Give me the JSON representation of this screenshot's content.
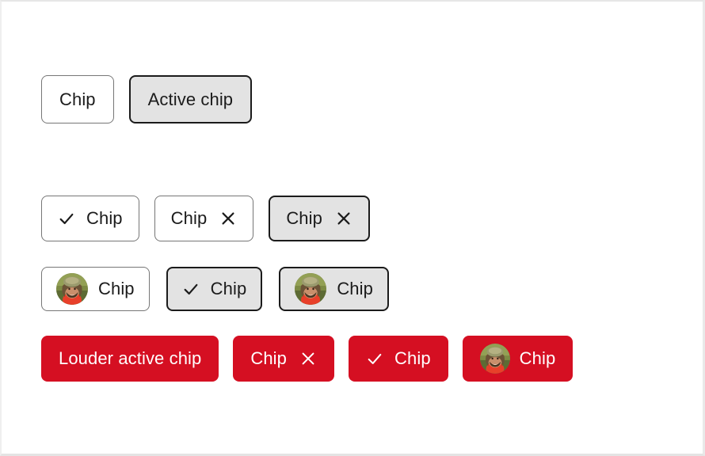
{
  "page": {
    "background": "#ffffff",
    "accent_red": "#d50f22",
    "border_gray": "#767676",
    "active_fill": "#e3e3e3",
    "text_color": "#1b1b1b"
  },
  "rows": {
    "basic": {
      "name": "basic-chips-row",
      "chips": [
        {
          "label": "Chip",
          "state": "default"
        },
        {
          "label": "Active chip",
          "state": "active"
        }
      ]
    },
    "icon_chips": {
      "name": "icon-chips-row",
      "chips": [
        {
          "label": "Chip",
          "leading_icon": "check-icon",
          "state": "default"
        },
        {
          "label": "Chip",
          "trailing_icon": "close-icon",
          "state": "default"
        },
        {
          "label": "Chip",
          "trailing_icon": "close-icon",
          "state": "active"
        }
      ]
    },
    "avatar_chips": {
      "name": "avatar-chips-row",
      "chips": [
        {
          "label": "Chip",
          "leading_icon": "avatar-icon",
          "state": "default"
        },
        {
          "label": "Chip",
          "leading_icon": "check-icon",
          "state": "active"
        },
        {
          "label": "Chip",
          "leading_icon": "avatar-icon",
          "state": "active"
        }
      ]
    },
    "louder_chips": {
      "name": "louder-chips-row",
      "chips": [
        {
          "label": "Louder active chip",
          "state": "louder"
        },
        {
          "label": "Chip",
          "trailing_icon": "close-icon",
          "state": "louder"
        },
        {
          "label": "Chip",
          "leading_icon": "check-icon",
          "state": "louder"
        },
        {
          "label": "Chip",
          "leading_icon": "avatar-icon",
          "state": "louder"
        }
      ]
    }
  }
}
